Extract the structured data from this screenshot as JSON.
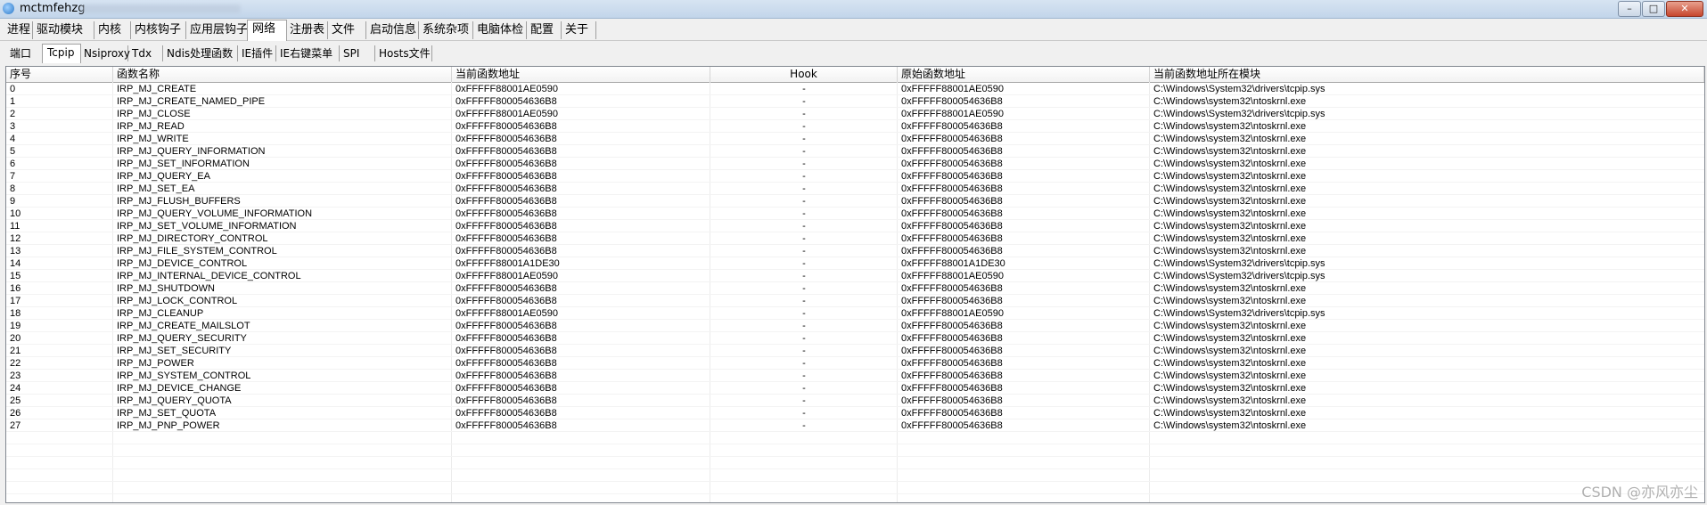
{
  "window": {
    "title": "mctmfehzg",
    "minimize_label": "–",
    "maximize_label": "□",
    "close_label": "✕"
  },
  "menu_tabs": [
    "进程",
    "驱动模块",
    "内核",
    "内核钩子",
    "应用层钩子",
    "网络",
    "注册表",
    "文件",
    "启动信息",
    "系统杂项",
    "电脑体检",
    "配置",
    "关于"
  ],
  "active_menu_tab": "网络",
  "sub_tabs": [
    "端口",
    "Tcpip",
    "Nsiproxy",
    "Tdx",
    "Ndis处理函数",
    "IE插件",
    "IE右键菜单",
    "SPI",
    "Hosts文件"
  ],
  "active_sub_tab": "Tcpip",
  "table": {
    "columns": [
      "序号",
      "函数名称",
      "当前函数地址",
      "Hook",
      "原始函数地址",
      "当前函数地址所在模块"
    ],
    "rows": [
      [
        "0",
        "IRP_MJ_CREATE",
        "0xFFFFF88001AE0590",
        "-",
        "0xFFFFF88001AE0590",
        "C:\\Windows\\System32\\drivers\\tcpip.sys"
      ],
      [
        "1",
        "IRP_MJ_CREATE_NAMED_PIPE",
        "0xFFFFF800054636B8",
        "-",
        "0xFFFFF800054636B8",
        "C:\\Windows\\system32\\ntoskrnl.exe"
      ],
      [
        "2",
        "IRP_MJ_CLOSE",
        "0xFFFFF88001AE0590",
        "-",
        "0xFFFFF88001AE0590",
        "C:\\Windows\\System32\\drivers\\tcpip.sys"
      ],
      [
        "3",
        "IRP_MJ_READ",
        "0xFFFFF800054636B8",
        "-",
        "0xFFFFF800054636B8",
        "C:\\Windows\\system32\\ntoskrnl.exe"
      ],
      [
        "4",
        "IRP_MJ_WRITE",
        "0xFFFFF800054636B8",
        "-",
        "0xFFFFF800054636B8",
        "C:\\Windows\\system32\\ntoskrnl.exe"
      ],
      [
        "5",
        "IRP_MJ_QUERY_INFORMATION",
        "0xFFFFF800054636B8",
        "-",
        "0xFFFFF800054636B8",
        "C:\\Windows\\system32\\ntoskrnl.exe"
      ],
      [
        "6",
        "IRP_MJ_SET_INFORMATION",
        "0xFFFFF800054636B8",
        "-",
        "0xFFFFF800054636B8",
        "C:\\Windows\\system32\\ntoskrnl.exe"
      ],
      [
        "7",
        "IRP_MJ_QUERY_EA",
        "0xFFFFF800054636B8",
        "-",
        "0xFFFFF800054636B8",
        "C:\\Windows\\system32\\ntoskrnl.exe"
      ],
      [
        "8",
        "IRP_MJ_SET_EA",
        "0xFFFFF800054636B8",
        "-",
        "0xFFFFF800054636B8",
        "C:\\Windows\\system32\\ntoskrnl.exe"
      ],
      [
        "9",
        "IRP_MJ_FLUSH_BUFFERS",
        "0xFFFFF800054636B8",
        "-",
        "0xFFFFF800054636B8",
        "C:\\Windows\\system32\\ntoskrnl.exe"
      ],
      [
        "10",
        "IRP_MJ_QUERY_VOLUME_INFORMATION",
        "0xFFFFF800054636B8",
        "-",
        "0xFFFFF800054636B8",
        "C:\\Windows\\system32\\ntoskrnl.exe"
      ],
      [
        "11",
        "IRP_MJ_SET_VOLUME_INFORMATION",
        "0xFFFFF800054636B8",
        "-",
        "0xFFFFF800054636B8",
        "C:\\Windows\\system32\\ntoskrnl.exe"
      ],
      [
        "12",
        "IRP_MJ_DIRECTORY_CONTROL",
        "0xFFFFF800054636B8",
        "-",
        "0xFFFFF800054636B8",
        "C:\\Windows\\system32\\ntoskrnl.exe"
      ],
      [
        "13",
        "IRP_MJ_FILE_SYSTEM_CONTROL",
        "0xFFFFF800054636B8",
        "-",
        "0xFFFFF800054636B8",
        "C:\\Windows\\system32\\ntoskrnl.exe"
      ],
      [
        "14",
        "IRP_MJ_DEVICE_CONTROL",
        "0xFFFFF88001A1DE30",
        "-",
        "0xFFFFF88001A1DE30",
        "C:\\Windows\\System32\\drivers\\tcpip.sys"
      ],
      [
        "15",
        "IRP_MJ_INTERNAL_DEVICE_CONTROL",
        "0xFFFFF88001AE0590",
        "-",
        "0xFFFFF88001AE0590",
        "C:\\Windows\\System32\\drivers\\tcpip.sys"
      ],
      [
        "16",
        "IRP_MJ_SHUTDOWN",
        "0xFFFFF800054636B8",
        "-",
        "0xFFFFF800054636B8",
        "C:\\Windows\\system32\\ntoskrnl.exe"
      ],
      [
        "17",
        "IRP_MJ_LOCK_CONTROL",
        "0xFFFFF800054636B8",
        "-",
        "0xFFFFF800054636B8",
        "C:\\Windows\\system32\\ntoskrnl.exe"
      ],
      [
        "18",
        "IRP_MJ_CLEANUP",
        "0xFFFFF88001AE0590",
        "-",
        "0xFFFFF88001AE0590",
        "C:\\Windows\\System32\\drivers\\tcpip.sys"
      ],
      [
        "19",
        "IRP_MJ_CREATE_MAILSLOT",
        "0xFFFFF800054636B8",
        "-",
        "0xFFFFF800054636B8",
        "C:\\Windows\\system32\\ntoskrnl.exe"
      ],
      [
        "20",
        "IRP_MJ_QUERY_SECURITY",
        "0xFFFFF800054636B8",
        "-",
        "0xFFFFF800054636B8",
        "C:\\Windows\\system32\\ntoskrnl.exe"
      ],
      [
        "21",
        "IRP_MJ_SET_SECURITY",
        "0xFFFFF800054636B8",
        "-",
        "0xFFFFF800054636B8",
        "C:\\Windows\\system32\\ntoskrnl.exe"
      ],
      [
        "22",
        "IRP_MJ_POWER",
        "0xFFFFF800054636B8",
        "-",
        "0xFFFFF800054636B8",
        "C:\\Windows\\system32\\ntoskrnl.exe"
      ],
      [
        "23",
        "IRP_MJ_SYSTEM_CONTROL",
        "0xFFFFF800054636B8",
        "-",
        "0xFFFFF800054636B8",
        "C:\\Windows\\system32\\ntoskrnl.exe"
      ],
      [
        "24",
        "IRP_MJ_DEVICE_CHANGE",
        "0xFFFFF800054636B8",
        "-",
        "0xFFFFF800054636B8",
        "C:\\Windows\\system32\\ntoskrnl.exe"
      ],
      [
        "25",
        "IRP_MJ_QUERY_QUOTA",
        "0xFFFFF800054636B8",
        "-",
        "0xFFFFF800054636B8",
        "C:\\Windows\\system32\\ntoskrnl.exe"
      ],
      [
        "26",
        "IRP_MJ_SET_QUOTA",
        "0xFFFFF800054636B8",
        "-",
        "0xFFFFF800054636B8",
        "C:\\Windows\\system32\\ntoskrnl.exe"
      ],
      [
        "27",
        "IRP_MJ_PNP_POWER",
        "0xFFFFF800054636B8",
        "-",
        "0xFFFFF800054636B8",
        "C:\\Windows\\system32\\ntoskrnl.exe"
      ]
    ]
  },
  "watermark": "CSDN @亦风亦尘"
}
